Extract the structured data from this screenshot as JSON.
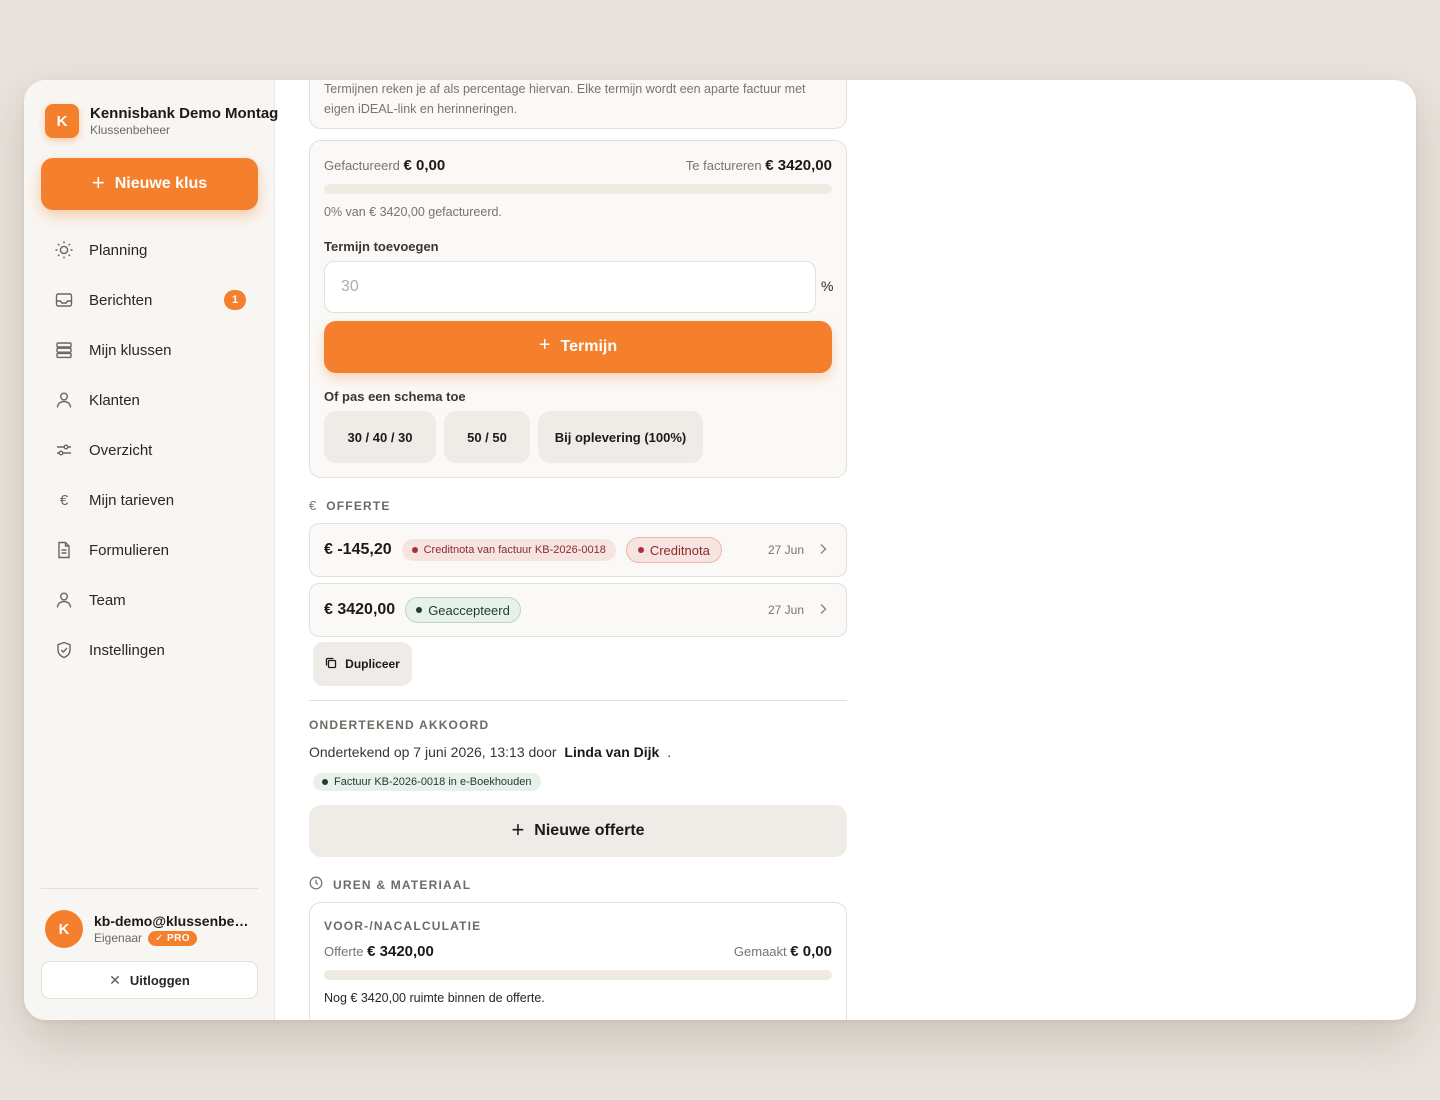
{
  "brand": {
    "initial": "K",
    "name": "Kennisbank Demo Montag",
    "subtitle": "Klussenbeheer"
  },
  "actions": {
    "new_job": "Nieuwe klus",
    "logout": "Uitloggen"
  },
  "sidebar": {
    "items": [
      {
        "label": "Planning",
        "icon": "sun-icon"
      },
      {
        "label": "Berichten",
        "icon": "inbox-icon",
        "badge": "1"
      },
      {
        "label": "Mijn klussen",
        "icon": "stack-icon"
      },
      {
        "label": "Klanten",
        "icon": "person-icon"
      },
      {
        "label": "Overzicht",
        "icon": "sliders-icon"
      },
      {
        "label": "Mijn tarieven",
        "icon": "euro-icon"
      },
      {
        "label": "Formulieren",
        "icon": "document-icon"
      },
      {
        "label": "Team",
        "icon": "person-icon"
      },
      {
        "label": "Instellingen",
        "icon": "shield-icon"
      }
    ]
  },
  "user": {
    "initial": "K",
    "email": "kb-demo@klussenbeheer.nl",
    "role": "Eigenaar",
    "plan": "PRO"
  },
  "termijnen": {
    "intro": "Termijnen reken je af als percentage hiervan. Elke termijn wordt een aparte factuur met eigen iDEAL-link en herinneringen.",
    "invoiced_label": "Gefactureerd",
    "invoiced_value": "€ 0,00",
    "to_invoice_label": "Te factureren",
    "to_invoice_value": "€ 3420,00",
    "progress_fraction": 0,
    "progress_text": "0% van € 3420,00 gefactureerd.",
    "add_label": "Termijn toevoegen",
    "input_placeholder": "30",
    "percent_sign": "%",
    "add_button": "Termijn",
    "schema_label": "Of pas een schema toe",
    "schemas": [
      "30 / 40 / 30",
      "50 / 50",
      "Bij oplevering (100%)"
    ]
  },
  "offerte": {
    "title": "OFFERTE",
    "quotes": [
      {
        "amount": "€ -145,20",
        "tag": "Creditnota van factuur KB-2026-0018",
        "status": "Creditnota",
        "date": "27 Jun"
      },
      {
        "amount": "€ 3420,00",
        "status": "Geaccepteerd",
        "date": "27 Jun"
      }
    ],
    "duplicate": "Dupliceer",
    "signed_title": "ONDERTEKEND AKKOORD",
    "signed_prefix": "Ondertekend op 7 juni 2026, 13:13 door",
    "signed_name": "Linda van Dijk",
    "signed_suffix": ".",
    "invoice_tag": "Factuur KB-2026-0018 in e-Boekhouden",
    "new_quote": "Nieuwe offerte"
  },
  "uren": {
    "title": "UREN & MATERIAAL",
    "calc_title": "VOOR-/NACALCULATIE",
    "quote_label": "Offerte",
    "quote_value": "€ 3420,00",
    "made_label": "Gemaakt",
    "made_value": "€ 0,00",
    "progress_fraction": 0,
    "remaining_text": "Nog € 3420,00 ruimte binnen de offerte."
  },
  "colors": {
    "accent": "#f47f2c",
    "danger": "#a83232",
    "success": "#1e3d2a"
  }
}
